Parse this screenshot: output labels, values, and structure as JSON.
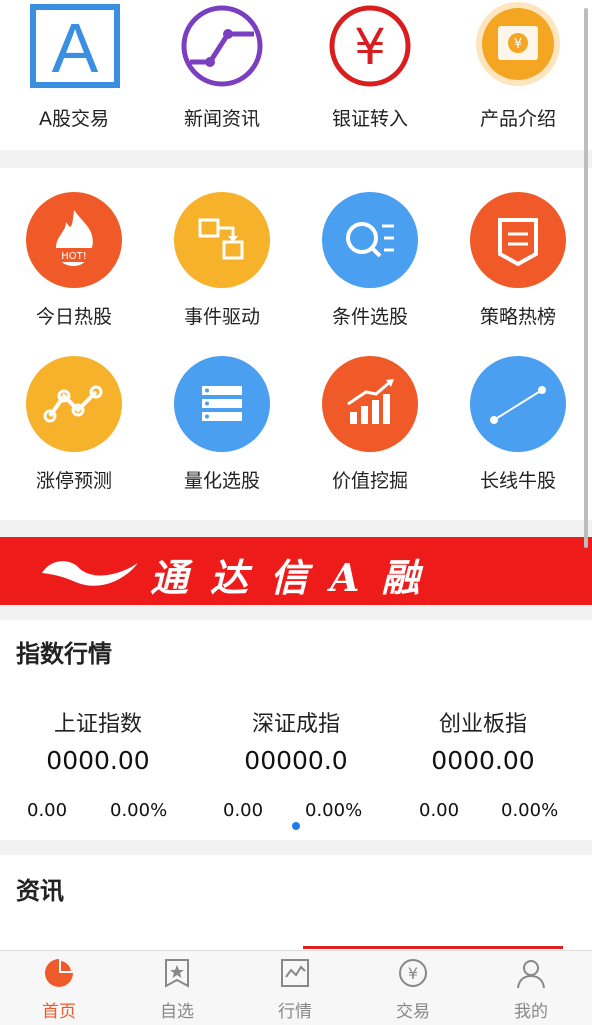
{
  "top_shortcuts": [
    {
      "label": "A股交易",
      "icon": "a-share-icon",
      "glyph": "A",
      "color": "#3b8fe0"
    },
    {
      "label": "新闻资讯",
      "icon": "news-trend-icon",
      "color": "#7a3fc0"
    },
    {
      "label": "银证转入",
      "icon": "yen-transfer-icon",
      "glyph": "¥",
      "color": "#d81e1e"
    },
    {
      "label": "产品介绍",
      "icon": "product-ticket-icon",
      "color": "#f4a623"
    }
  ],
  "feature_grid": [
    {
      "label": "今日热股",
      "icon": "hot-fire-icon",
      "glyph": "HOT",
      "color": "#f05a28"
    },
    {
      "label": "事件驱动",
      "icon": "event-flow-icon",
      "color": "#f7b22c"
    },
    {
      "label": "条件选股",
      "icon": "filter-search-icon",
      "color": "#4a9ff0"
    },
    {
      "label": "策略热榜",
      "icon": "strategy-banner-icon",
      "color": "#f05a28"
    },
    {
      "label": "涨停预测",
      "icon": "rise-forecast-icon",
      "color": "#f7b22c"
    },
    {
      "label": "量化选股",
      "icon": "quant-list-icon",
      "color": "#4a9ff0"
    },
    {
      "label": "价值挖掘",
      "icon": "value-chart-icon",
      "color": "#f05a28"
    },
    {
      "label": "长线牛股",
      "icon": "long-line-icon",
      "color": "#4a9ff0"
    }
  ],
  "banner": {
    "text": "通达信A融",
    "color": "#ee1b1b"
  },
  "index_section": {
    "title": "指数行情",
    "indices": [
      {
        "name": "上证指数",
        "value": "0000.00",
        "change": "0.00",
        "pct": "0.00%"
      },
      {
        "name": "深证成指",
        "value": "00000.0",
        "change": "0.00",
        "pct": "0.00%"
      },
      {
        "name": "创业板指",
        "value": "0000.00",
        "change": "0.00",
        "pct": "0.00%"
      }
    ],
    "pager": {
      "pages": 1,
      "current": 1
    }
  },
  "news_section": {
    "title": "资讯"
  },
  "tabbar": {
    "active_color": "#ef5a2a",
    "items": [
      {
        "label": "首页",
        "icon": "home-pie-icon",
        "active": true
      },
      {
        "label": "自选",
        "icon": "favorites-star-icon",
        "active": false
      },
      {
        "label": "行情",
        "icon": "market-chart-icon",
        "active": false
      },
      {
        "label": "交易",
        "icon": "trade-yen-icon",
        "active": false
      },
      {
        "label": "我的",
        "icon": "profile-user-icon",
        "active": false
      }
    ]
  }
}
